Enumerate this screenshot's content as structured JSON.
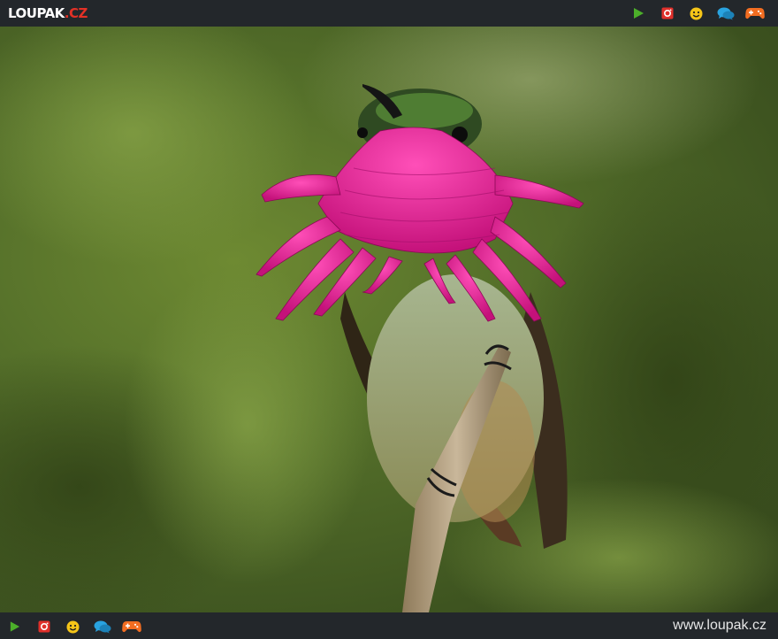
{
  "header": {
    "logo_main": "LOUPAK",
    "logo_suffix": ".CZ",
    "icons": [
      "play-icon",
      "instagram-icon",
      "smiley-icon",
      "chat-icon",
      "gamepad-icon"
    ]
  },
  "footer": {
    "icons": [
      "play-icon",
      "instagram-icon",
      "smiley-icon",
      "chat-icon",
      "gamepad-icon"
    ],
    "site_url": "www.loupak.cz"
  },
  "image": {
    "subject": "hummingbird"
  },
  "colors": {
    "bar_bg": "#23272b",
    "play": "#4caf2a",
    "instagram": "#e0302b",
    "smiley": "#f5c518",
    "chat": "#29a3e0",
    "gamepad": "#f26d21",
    "gorget": "#e0218a"
  }
}
